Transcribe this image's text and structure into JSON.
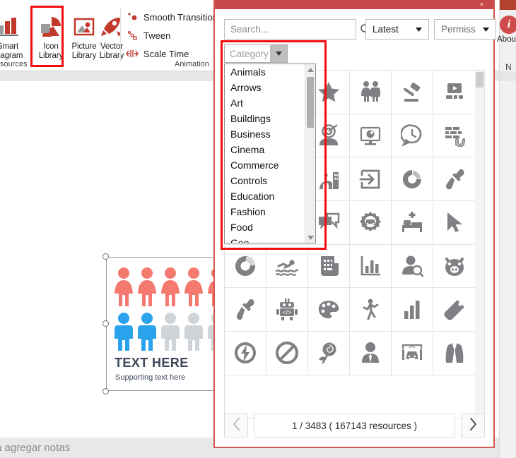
{
  "ribbon": {
    "buttons": [
      {
        "name": "smart-diagram",
        "line1": "Smart",
        "line2": "Diagram",
        "icon": "bar-chart-icon"
      },
      {
        "name": "icon-library",
        "line1": "Icon",
        "line2": "Library",
        "icon": "pie-chart-icon"
      },
      {
        "name": "picture-library",
        "line1": "Picture",
        "line2": "Library",
        "icon": "picture-icon"
      },
      {
        "name": "vector-library",
        "line1": "Vector",
        "line2": "Library",
        "icon": "rocket-icon"
      }
    ],
    "group_labels": {
      "resources": "Resources",
      "animation": "Animation"
    },
    "animation_commands": [
      {
        "label": "Smooth Transition",
        "icon": "smooth-transition-icon"
      },
      {
        "label": "Tween",
        "icon": "tween-icon"
      },
      {
        "label": "Scale Time",
        "icon": "scale-time-icon"
      }
    ]
  },
  "right_rail": {
    "about_label": "About",
    "about_icon": "info-icon",
    "notes_letter": "N"
  },
  "slide": {
    "title_text": "TEXT HERE",
    "subtitle_text": "Supporting text here",
    "row1_color": "#f4796f",
    "row1_count": 5,
    "row2_colors": [
      "#2aa3ec",
      "#2aa3ec",
      "#cfd4d8",
      "#cfd4d8",
      "#cfd4d8"
    ]
  },
  "notes_bar": {
    "text": "a agregar notas"
  },
  "panel": {
    "close_label": "×",
    "search": {
      "value": "",
      "placeholder": "Search...",
      "icon": "search-icon"
    },
    "sort_combo": {
      "value": "Latest",
      "icon": "chevron-down-icon"
    },
    "permission_combo": {
      "value": "Permissio",
      "icon": "chevron-down-icon"
    },
    "category_combo": {
      "value": "Category",
      "icon": "chevron-down-icon"
    },
    "category_list": [
      "Animals",
      "Arrows",
      "Art",
      "Buildings",
      "Business",
      "Cinema",
      "Commerce",
      "Controls",
      "Education",
      "Fashion",
      "Food",
      "Geo"
    ],
    "pagination": {
      "prev_icon": "chevron-left-icon",
      "next_icon": "chevron-right-icon",
      "info": "1 / 3483 ( 167143 resources )"
    },
    "grid_icons": [
      "globe-search-icon",
      "user-analytics-icon",
      "star-icon",
      "couple-icon",
      "clipboard-list-icon",
      "officer-shield-icon",
      "target-person-icon",
      "monitor-eye-icon",
      "gavel-icon",
      "clock-pin-icon",
      "video-presentation-icon",
      "brick-wall-hand-icon",
      "person-tie-icon",
      "adult-child-walking-icon",
      "city-landmark-icon",
      "login-arrow-icon",
      "presentation-person-icon",
      "sword-icon",
      "chat-bubbles-icon",
      "car-gear-icon",
      "hospital-bed-icon",
      "cursor-arrow-icon",
      "donut-chart-icon",
      "swimmer-icon",
      "receipt-icon",
      "bar-chart-icon",
      "user-search-icon",
      "pig-icon",
      "pipette-icon",
      "code-robot-icon",
      "palette-icon",
      "walking-person-icon",
      "bar-graph-icon",
      "price-tag-icon",
      "power-bolt-icon",
      "no-entry-icon",
      "rose-icon",
      "person-avatar-icon",
      "car-wash-icon",
      "suit-jacket-icon"
    ]
  },
  "colors": {
    "panel_border": "#d3594f",
    "panel_title": "#c9484a",
    "highlight": "#f20d0d",
    "accent_red": "#c0392b",
    "icon_gray": "#7e8083"
  }
}
